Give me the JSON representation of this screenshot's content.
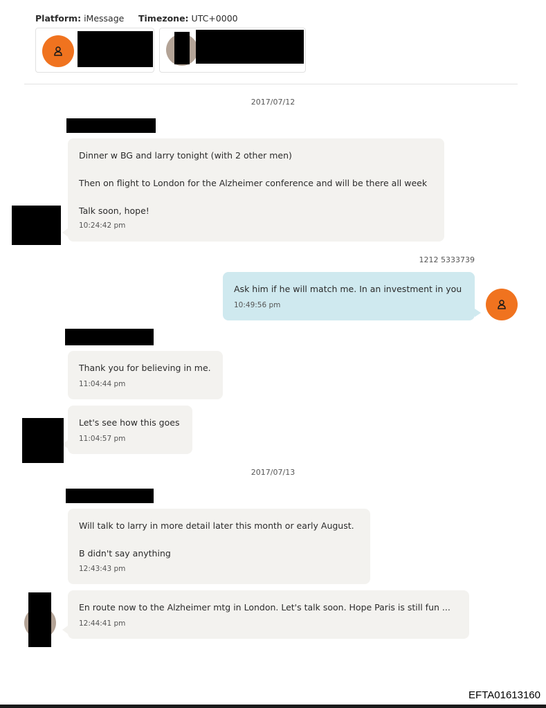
{
  "header": {
    "platform_label": "Platform:",
    "platform_value": "iMessage",
    "timezone_label": "Timezone:",
    "timezone_value": "UTC+0000"
  },
  "participants": [
    {
      "avatar": "person-icon",
      "name": "[redacted]"
    },
    {
      "avatar": "photo",
      "name": "[redacted]"
    }
  ],
  "days": [
    {
      "date": "2017/07/12"
    },
    {
      "date": "2017/07/13"
    }
  ],
  "messages": [
    {
      "direction": "received",
      "lines": [
        "Dinner w BG and larry tonight (with 2 other men)",
        "Then on flight to London for the Alzheimer conference and will be there all week",
        "Talk soon, hope!"
      ],
      "time": "10:24:42 pm"
    },
    {
      "direction": "sent",
      "sender": "1212 5333739",
      "lines": [
        "Ask him if he will match me. In an investment in you"
      ],
      "time": "10:49:56 pm"
    },
    {
      "direction": "received",
      "lines": [
        "Thank you for believing in me."
      ],
      "time": "11:04:44 pm"
    },
    {
      "direction": "received",
      "lines": [
        "Let's see how this goes"
      ],
      "time": "11:04:57 pm"
    },
    {
      "direction": "received",
      "lines": [
        "Will talk to larry in more detail later this month or early August.",
        "B didn't say anything"
      ],
      "time": "12:43:43 pm"
    },
    {
      "direction": "received",
      "lines": [
        "En route now to the Alzheimer mtg in London. Let's talk soon. Hope Paris is still fun ..."
      ],
      "time": "12:44:41 pm"
    }
  ],
  "footer": {
    "doc_id": "EFTA01613160"
  },
  "colors": {
    "accent_orange": "#f0731f",
    "sent_bubble": "#cfe9ef",
    "received_bubble": "#f3f2ef"
  }
}
